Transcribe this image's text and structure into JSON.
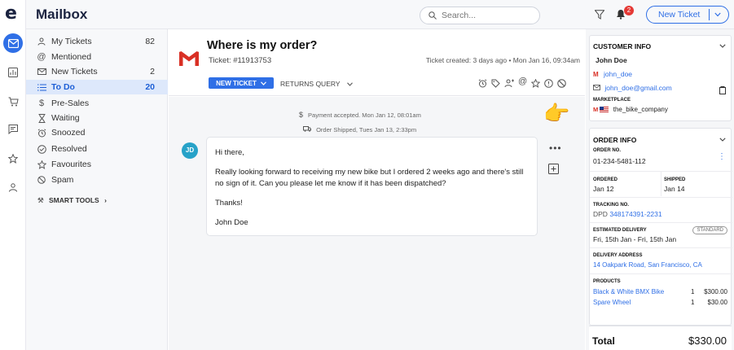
{
  "app": {
    "title": "Mailbox",
    "logo": "e"
  },
  "search": {
    "placeholder": "Search..."
  },
  "notifications": {
    "count": "2"
  },
  "top_new_ticket": {
    "label": "New Ticket"
  },
  "nav": [
    {
      "label": "My Tickets",
      "count": "82"
    },
    {
      "label": "Mentioned",
      "count": ""
    },
    {
      "label": "New Tickets",
      "count": "2"
    },
    {
      "label": "To Do",
      "count": "20"
    },
    {
      "label": "Pre-Sales",
      "count": ""
    },
    {
      "label": "Waiting",
      "count": ""
    },
    {
      "label": "Snoozed",
      "count": ""
    },
    {
      "label": "Resolved",
      "count": ""
    },
    {
      "label": "Favourites",
      "count": ""
    },
    {
      "label": "Spam",
      "count": ""
    }
  ],
  "smart_tools": {
    "label": "SMART TOOLS"
  },
  "ticket": {
    "subject": "Where is my order?",
    "number": "Ticket: #11913753",
    "created": "Ticket created: 3 days ago  •  Mon Jan 16, 09:34am",
    "new_ticket_btn": "NEW TICKET",
    "returns_query": "RETURNS QUERY"
  },
  "events": [
    {
      "text": "Payment accepted. Mon Jan 12, 08:01am"
    },
    {
      "text": "Order Shipped, Tues Jan 13, 2:33pm"
    }
  ],
  "message": {
    "avatar": "JD",
    "lines": [
      "Hi there,",
      "Really looking forward to receiving my new bike but I ordered 2 weeks ago and there's still no sign of it. Can you please let me know if it has been dispatched?",
      "Thanks!",
      "John Doe"
    ],
    "menu": "•••"
  },
  "customer": {
    "header": "CUSTOMER INFO",
    "name": "John Doe",
    "username": "john_doe",
    "email": "john_doe@gmail.com",
    "marketplace_label": "MARKETPLACE",
    "marketplace": "the_bike_company"
  },
  "order": {
    "header": "ORDER INFO",
    "order_no_label": "ORDER NO.",
    "order_no": "01-234-5481-112",
    "ordered_label": "ORDERED",
    "ordered": "Jan 12",
    "shipped_label": "SHIPPED",
    "shipped": "Jan 14",
    "tracking_label": "TRACKING NO.",
    "tracking_carrier": "DPD",
    "tracking_no": "348174391-2231",
    "est_label": "ESTIMATED DELIVERY",
    "est_badge": "STANDARD",
    "est": "Fri, 15th Jan - Fri, 15th Jan",
    "addr_label": "DELIVERY ADDRESS",
    "addr": "14 Oakpark Road, San Francisco, CA",
    "products_label": "PRODUCTS",
    "products": [
      {
        "name": "Black & White BMX Bike",
        "qty": "1",
        "price": "$300.00"
      },
      {
        "name": "Spare Wheel",
        "qty": "1",
        "price": "$30.00"
      }
    ]
  },
  "total": {
    "label": "Total",
    "value": "$330.00"
  },
  "colors": {
    "accent": "#2f6fe6",
    "active_bg": "#dde8fb",
    "badge": "#e53935",
    "avatar": "#27a2c8"
  }
}
